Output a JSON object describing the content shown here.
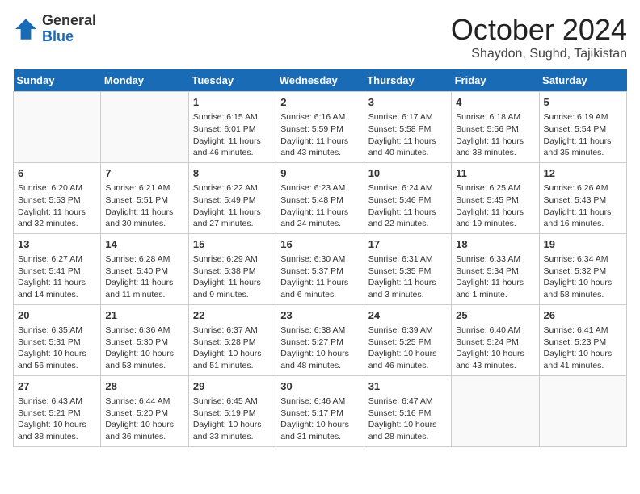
{
  "header": {
    "logo_line1": "General",
    "logo_line2": "Blue",
    "month_title": "October 2024",
    "location": "Shaydon, Sughd, Tajikistan"
  },
  "days_of_week": [
    "Sunday",
    "Monday",
    "Tuesday",
    "Wednesday",
    "Thursday",
    "Friday",
    "Saturday"
  ],
  "weeks": [
    [
      {
        "day": "",
        "empty": true
      },
      {
        "day": "",
        "empty": true
      },
      {
        "day": "1",
        "sunrise": "6:15 AM",
        "sunset": "6:01 PM",
        "daylight": "11 hours and 46 minutes."
      },
      {
        "day": "2",
        "sunrise": "6:16 AM",
        "sunset": "5:59 PM",
        "daylight": "11 hours and 43 minutes."
      },
      {
        "day": "3",
        "sunrise": "6:17 AM",
        "sunset": "5:58 PM",
        "daylight": "11 hours and 40 minutes."
      },
      {
        "day": "4",
        "sunrise": "6:18 AM",
        "sunset": "5:56 PM",
        "daylight": "11 hours and 38 minutes."
      },
      {
        "day": "5",
        "sunrise": "6:19 AM",
        "sunset": "5:54 PM",
        "daylight": "11 hours and 35 minutes."
      }
    ],
    [
      {
        "day": "6",
        "sunrise": "6:20 AM",
        "sunset": "5:53 PM",
        "daylight": "11 hours and 32 minutes."
      },
      {
        "day": "7",
        "sunrise": "6:21 AM",
        "sunset": "5:51 PM",
        "daylight": "11 hours and 30 minutes."
      },
      {
        "day": "8",
        "sunrise": "6:22 AM",
        "sunset": "5:49 PM",
        "daylight": "11 hours and 27 minutes."
      },
      {
        "day": "9",
        "sunrise": "6:23 AM",
        "sunset": "5:48 PM",
        "daylight": "11 hours and 24 minutes."
      },
      {
        "day": "10",
        "sunrise": "6:24 AM",
        "sunset": "5:46 PM",
        "daylight": "11 hours and 22 minutes."
      },
      {
        "day": "11",
        "sunrise": "6:25 AM",
        "sunset": "5:45 PM",
        "daylight": "11 hours and 19 minutes."
      },
      {
        "day": "12",
        "sunrise": "6:26 AM",
        "sunset": "5:43 PM",
        "daylight": "11 hours and 16 minutes."
      }
    ],
    [
      {
        "day": "13",
        "sunrise": "6:27 AM",
        "sunset": "5:41 PM",
        "daylight": "11 hours and 14 minutes."
      },
      {
        "day": "14",
        "sunrise": "6:28 AM",
        "sunset": "5:40 PM",
        "daylight": "11 hours and 11 minutes."
      },
      {
        "day": "15",
        "sunrise": "6:29 AM",
        "sunset": "5:38 PM",
        "daylight": "11 hours and 9 minutes."
      },
      {
        "day": "16",
        "sunrise": "6:30 AM",
        "sunset": "5:37 PM",
        "daylight": "11 hours and 6 minutes."
      },
      {
        "day": "17",
        "sunrise": "6:31 AM",
        "sunset": "5:35 PM",
        "daylight": "11 hours and 3 minutes."
      },
      {
        "day": "18",
        "sunrise": "6:33 AM",
        "sunset": "5:34 PM",
        "daylight": "11 hours and 1 minute."
      },
      {
        "day": "19",
        "sunrise": "6:34 AM",
        "sunset": "5:32 PM",
        "daylight": "10 hours and 58 minutes."
      }
    ],
    [
      {
        "day": "20",
        "sunrise": "6:35 AM",
        "sunset": "5:31 PM",
        "daylight": "10 hours and 56 minutes."
      },
      {
        "day": "21",
        "sunrise": "6:36 AM",
        "sunset": "5:30 PM",
        "daylight": "10 hours and 53 minutes."
      },
      {
        "day": "22",
        "sunrise": "6:37 AM",
        "sunset": "5:28 PM",
        "daylight": "10 hours and 51 minutes."
      },
      {
        "day": "23",
        "sunrise": "6:38 AM",
        "sunset": "5:27 PM",
        "daylight": "10 hours and 48 minutes."
      },
      {
        "day": "24",
        "sunrise": "6:39 AM",
        "sunset": "5:25 PM",
        "daylight": "10 hours and 46 minutes."
      },
      {
        "day": "25",
        "sunrise": "6:40 AM",
        "sunset": "5:24 PM",
        "daylight": "10 hours and 43 minutes."
      },
      {
        "day": "26",
        "sunrise": "6:41 AM",
        "sunset": "5:23 PM",
        "daylight": "10 hours and 41 minutes."
      }
    ],
    [
      {
        "day": "27",
        "sunrise": "6:43 AM",
        "sunset": "5:21 PM",
        "daylight": "10 hours and 38 minutes."
      },
      {
        "day": "28",
        "sunrise": "6:44 AM",
        "sunset": "5:20 PM",
        "daylight": "10 hours and 36 minutes."
      },
      {
        "day": "29",
        "sunrise": "6:45 AM",
        "sunset": "5:19 PM",
        "daylight": "10 hours and 33 minutes."
      },
      {
        "day": "30",
        "sunrise": "6:46 AM",
        "sunset": "5:17 PM",
        "daylight": "10 hours and 31 minutes."
      },
      {
        "day": "31",
        "sunrise": "6:47 AM",
        "sunset": "5:16 PM",
        "daylight": "10 hours and 28 minutes."
      },
      {
        "day": "",
        "empty": true
      },
      {
        "day": "",
        "empty": true
      }
    ]
  ]
}
